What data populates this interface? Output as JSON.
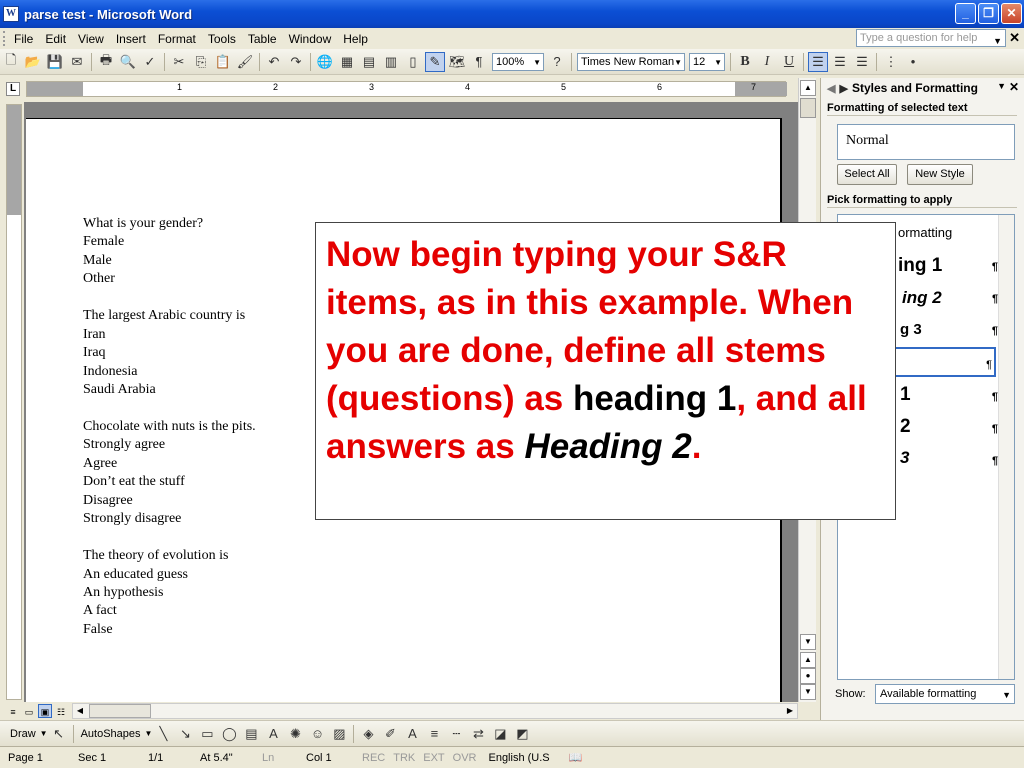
{
  "window": {
    "title": "parse test - Microsoft Word"
  },
  "menu": {
    "items": [
      {
        "label": "File"
      },
      {
        "label": "Edit"
      },
      {
        "label": "View"
      },
      {
        "label": "Insert"
      },
      {
        "label": "Format"
      },
      {
        "label": "Tools"
      },
      {
        "label": "Table"
      },
      {
        "label": "Window"
      },
      {
        "label": "Help"
      }
    ],
    "help_placeholder": "Type a question for help"
  },
  "toolbar": {
    "zoom": "100%",
    "font": "Times New Roman",
    "font_size": "12"
  },
  "ruler": {
    "numbers": [
      "1",
      "2",
      "3",
      "4",
      "5",
      "6",
      "7"
    ]
  },
  "document": {
    "lines": [
      "What is your gender?",
      "Female",
      "Male",
      "Other",
      "",
      "The largest Arabic country is",
      "Iran",
      "Iraq",
      "Indonesia",
      "Saudi Arabia",
      "",
      "Chocolate with nuts is the pits.",
      "Strongly agree",
      "Agree",
      "Don’t eat the stuff",
      "Disagree",
      "Strongly disagree",
      "",
      "The theory of evolution is",
      "An educated guess",
      "An hypothesis",
      "A fact",
      "False"
    ]
  },
  "callout": {
    "part1": "Now begin typing your S&R items, as in this example. When you are done, define all stems (questions) as ",
    "part2": "heading 1",
    "part3": ", and all answers as ",
    "part4": "Heading 2",
    "part5": "."
  },
  "taskpane": {
    "title": "Styles and Formatting",
    "section_selected": "Formatting of selected text",
    "current_style": "Normal",
    "select_all": "Select All",
    "new_style": "New Style",
    "section_pick": "Pick formatting to apply",
    "list_items": [
      "ormatting",
      "ing 1",
      "ing 2",
      "g 3",
      "",
      "1",
      "2",
      "3"
    ],
    "show_label": "Show:",
    "show_value": "Available formatting"
  },
  "drawbar": {
    "draw": "Draw",
    "autoshapes": "AutoShapes"
  },
  "status": {
    "page": "Page 1",
    "sec": "Sec 1",
    "pages": "1/1",
    "at": "At 5.4\"",
    "ln": "Ln",
    "col": "Col 1",
    "rec": "REC",
    "trk": "TRK",
    "ext": "EXT",
    "ovr": "OVR",
    "lang": "English (U.S"
  },
  "icons": {
    "paragraph_mark": "¶"
  }
}
